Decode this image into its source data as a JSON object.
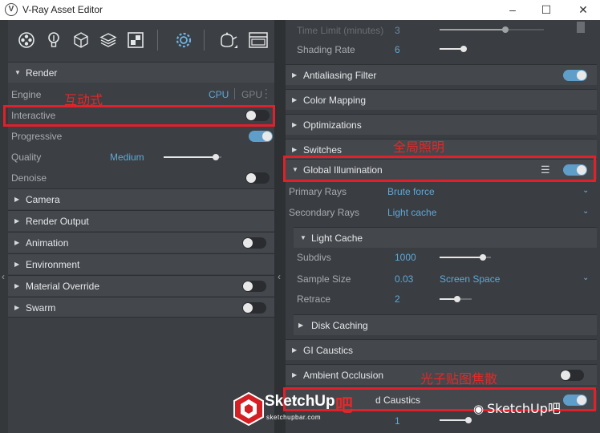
{
  "window": {
    "title": "V-Ray Asset Editor",
    "logo_letter": "V",
    "controls": [
      "–",
      "☐",
      "✕"
    ]
  },
  "toolbar": {
    "icons": [
      "materials-icon",
      "lights-icon",
      "geometry-icon",
      "render-elements-icon",
      "textures-icon",
      "settings-icon",
      "render-icon",
      "frame-buffer-icon"
    ]
  },
  "left": {
    "render": {
      "header": "Render",
      "engine_label": "Engine",
      "engine_cpu": "CPU",
      "engine_gpu": "GPU",
      "interactive_label": "Interactive",
      "interactive_on": false,
      "progressive_label": "Progressive",
      "progressive_on": true,
      "quality_label": "Quality",
      "quality_value": "Medium",
      "quality_level": 0.9,
      "denoise_label": "Denoise",
      "denoise_on": false
    },
    "sections": [
      {
        "label": "Camera",
        "toggle": null
      },
      {
        "label": "Render Output",
        "toggle": null
      },
      {
        "label": "Animation",
        "toggle": false
      },
      {
        "label": "Environment",
        "toggle": null
      },
      {
        "label": "Material Override",
        "toggle": false
      },
      {
        "label": "Swarm",
        "toggle": false
      }
    ]
  },
  "right": {
    "time_limit_label": "Time Limit (minutes)",
    "time_limit_value": "3",
    "shading_rate_label": "Shading Rate",
    "shading_rate_value": "6",
    "sections": {
      "antialiasing": "Antialiasing Filter",
      "color_mapping": "Color Mapping",
      "optimizations": "Optimizations",
      "switches": "Switches",
      "global_illumination": "Global Illumination",
      "gi_caustics": "GI Caustics",
      "ambient_occlusion": "Ambient Occlusion",
      "caustics": "d Caustics"
    },
    "gi": {
      "primary_label": "Primary Rays",
      "primary_value": "Brute force",
      "secondary_label": "Secondary Rays",
      "secondary_value": "Light cache"
    },
    "light_cache": {
      "header": "Light Cache",
      "subdivs_label": "Subdivs",
      "subdivs_value": "1000",
      "subdivs_level": 0.85,
      "sample_size_label": "Sample Size",
      "sample_size_value": "0.03",
      "sample_size_mode": "Screen Space",
      "retrace_label": "Retrace",
      "retrace_value": "2",
      "retrace_level": 0.55,
      "disk_caching": "Disk Caching"
    },
    "bottom_value": "1"
  },
  "annotations": {
    "interactive": "互动式",
    "gi": "全局照明",
    "caustics": "光子贴图焦散"
  },
  "watermark": {
    "brand": "SketchUp",
    "brand_suffix": "吧",
    "site": "sketchupbar.com",
    "right_text": "SketchUp吧"
  },
  "colors": {
    "accent": "#5f9ec9",
    "value_blue": "#5fa9d8",
    "annotation_red": "#e0202a"
  }
}
